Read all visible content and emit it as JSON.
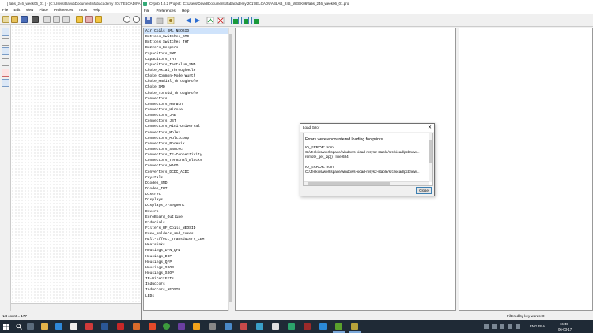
{
  "background_window": {
    "title": "[ fabs_246_week06_01 ] - [C:\\Users\\David\\Documents\\fabacademy 2017\\ELCAD\\FAB...",
    "menu": [
      "File",
      "Edit",
      "View",
      "Place",
      "Preferences",
      "Tools",
      "Help"
    ],
    "status": "Net count = 177"
  },
  "cvpcb": {
    "title": "Cvpcb 4.0.2  Project: 'C:\\Users\\David\\Documents\\fabacademy 2017\\ELCAD\\FABLAB_246_WEEK06\\fabs_246_week06_01.pro'",
    "menu": [
      "File",
      "Preferences",
      "Help"
    ],
    "libraries": [
      "Air_Coils_SML_NEOSID",
      "Buttons_Switches_SMD",
      "Buttons_Switches_THT",
      "Buzzers_Beepers",
      "Capacitors_SMD",
      "Capacitors_THT",
      "Capacitors_Tantalum_SMD",
      "Choke_Axial_ThroughHole",
      "Choke_Common-Mode_Wurth",
      "Choke_Radial_ThroughHole",
      "Choke_SMD",
      "Choke_Toroid_ThroughHole",
      "Connectors",
      "Connectors_Harwin",
      "Connectors_Hirose",
      "Connectors_JAE",
      "Connectors_JST",
      "Connectors_Mini-Universal",
      "Connectors_Molex",
      "Connectors_Multicomp",
      "Connectors_Phoenix",
      "Connectors_Samtec",
      "Connectors_TE-Connectivity",
      "Connectors_Terminal_Blocks",
      "Connectors_WAGO",
      "Converters_DCDC_ACDC",
      "Crystals",
      "Diodes_SMD",
      "Diodes_THT",
      "Discret",
      "Displays",
      "Displays_7-Segment",
      "Divers",
      "EuroBoard_Outline",
      "Fiducials",
      "Filters_HF_Coils_NEOSID",
      "Fuse_Holders_and_Fuses",
      "Hall-Effect_Transducers_LEM",
      "Heatsinks",
      "Housings_DFN_QFN",
      "Housings_DIP",
      "Housings_QFP",
      "Housings_SSOP",
      "Housings_SSOP",
      "IR-DirectFETs",
      "Inductors",
      "Inductors_NEOSID",
      "LEDs"
    ],
    "status_filter": "Filtered by key words: 0"
  },
  "dialog": {
    "title": "Load Error",
    "close_glyph": "✕",
    "heading": "Errors were encountered loading footprints:",
    "lines": [
      "IO_ERROR: from",
      "C:/Jenkins/workspace/windows-kicad-msys2-stable/src/kicad/pcbnew...",
      "  remote_get_zip() : line 684",
      "IO_ERROR: from",
      "C:/Jenkins/workspace/windows-kicad-msys2-stable/src/kicad/pcbnew..."
    ],
    "close_button": "Close"
  },
  "taskbar": {
    "language": "ENG",
    "region": "FRA",
    "time": "16:45",
    "date": "06-03-17"
  },
  "colors": {
    "accent": "#3c7fb1",
    "selection": "#cfe3fb",
    "taskbar": "#1f2a36"
  }
}
